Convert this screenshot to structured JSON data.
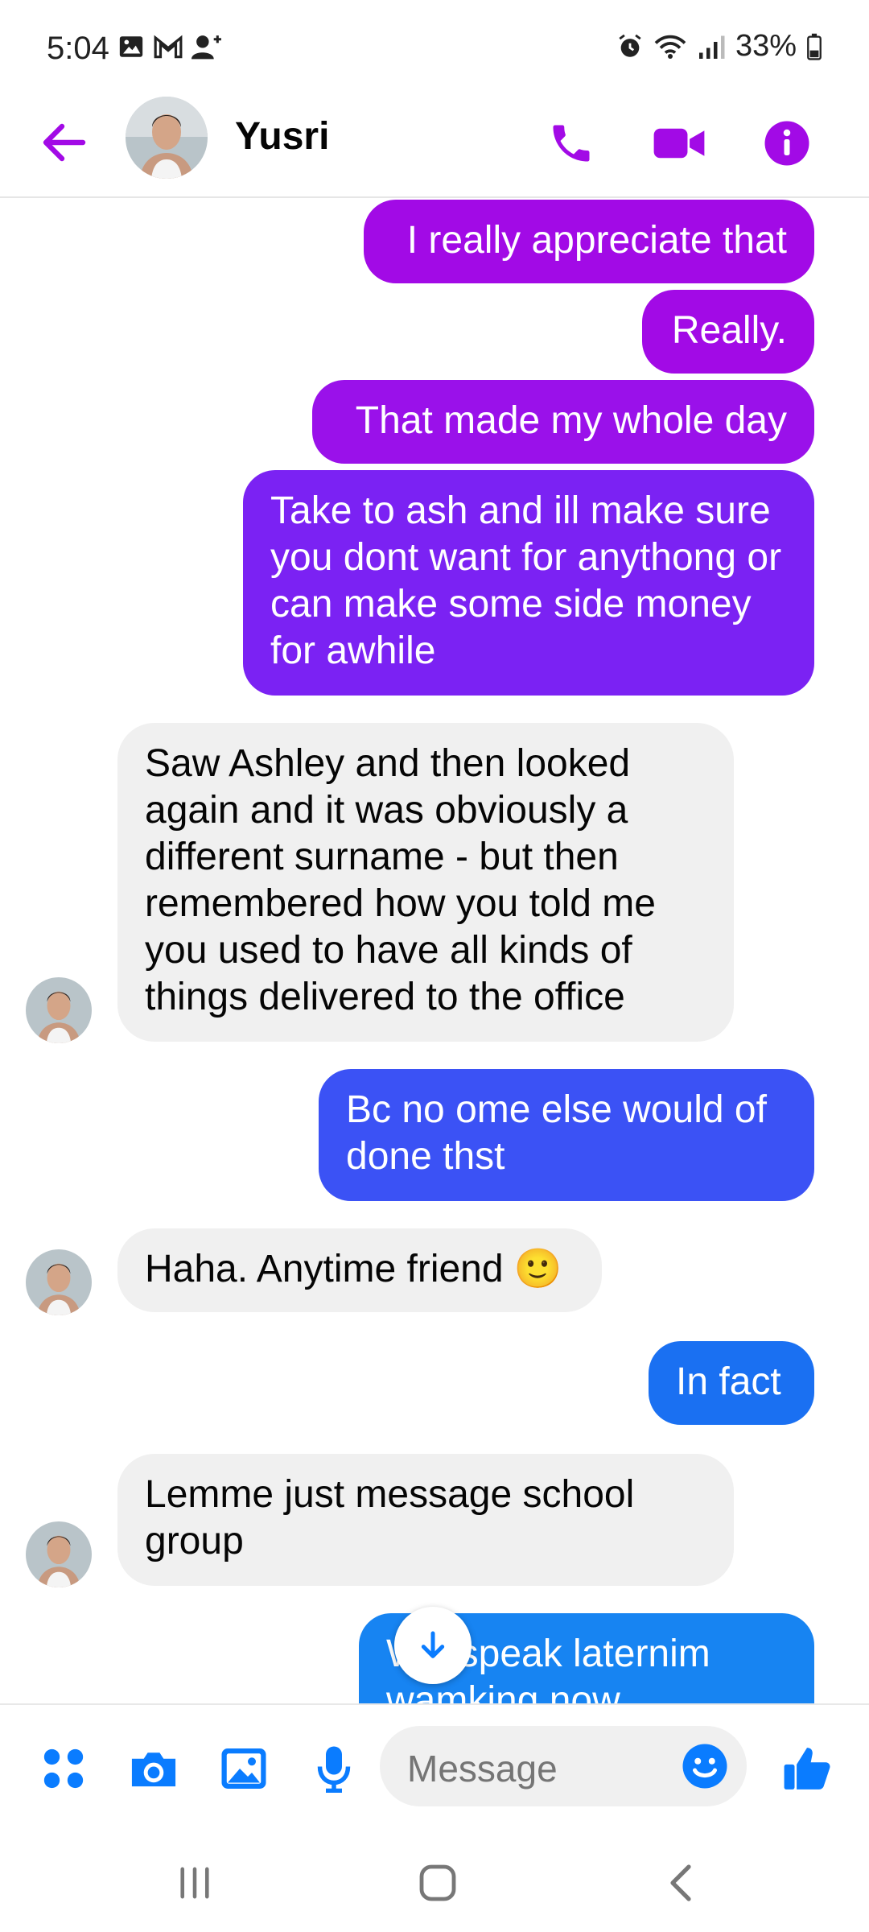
{
  "status_bar": {
    "time": "5:04",
    "battery": "33%"
  },
  "header": {
    "contact_name": "Yusri"
  },
  "messages": [
    {
      "dir": "out",
      "text": "I really appreciate that",
      "color": "#a20ae6"
    },
    {
      "dir": "out",
      "text": "Really.",
      "color": "#a20ae6"
    },
    {
      "dir": "out",
      "text": "That made my whole day",
      "color": "#9a11ea"
    },
    {
      "dir": "out",
      "text": "Take to ash and ill make sure you dont want for anythong or can make some side money for awhile",
      "color": "#7b22f3"
    },
    {
      "dir": "in",
      "text": "Saw Ashley and then looked again and it was obviously a different surname - but then remembered how you told me you used to have all kinds of things delivered to the office"
    },
    {
      "dir": "out",
      "text": "Bc no ome else would of done thst",
      "color": "#3b52f5"
    },
    {
      "dir": "in",
      "text": "Haha. Anytime friend 🙂"
    },
    {
      "dir": "out",
      "text": "In fact",
      "color": "#1a70f2"
    },
    {
      "dir": "in",
      "text": "Lemme just message school group"
    },
    {
      "dir": "out",
      "text": "Will speak laternim wamking now",
      "color": "#1784f2"
    }
  ],
  "composer": {
    "placeholder": "Message"
  },
  "colors": {
    "header_accent": "#a20ae6",
    "composer_accent": "#0a7cff",
    "incoming_bubble": "#f0f0f0"
  }
}
